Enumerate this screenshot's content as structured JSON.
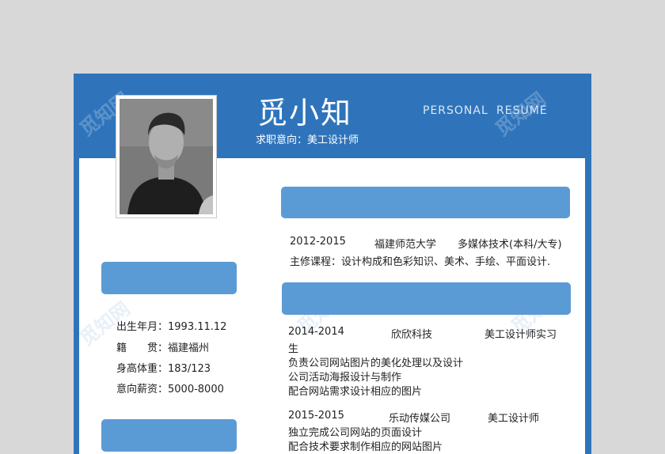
{
  "header": {
    "name": "觅小知",
    "job_intent": "求职意向：美工设计师",
    "en_word_1": "PERSONAL",
    "en_word_2": "RESUME"
  },
  "personal_info": [
    {
      "label": "出生年月：",
      "value": "1993.11.12"
    },
    {
      "label": "籍　　贯：",
      "value": "福建福州"
    },
    {
      "label": "身高体重：",
      "value": "183/123"
    },
    {
      "label": "意向薪资：",
      "value": "5000-8000"
    }
  ],
  "education": {
    "period": "2012-2015",
    "school": "福建师范大学",
    "major": "多媒体技术(本科/大专)",
    "courses": "主修课程：设计构成和色彩知识、美术、手绘、平面设计."
  },
  "experience": [
    {
      "period": "2014-2014",
      "company": "欣欣科技",
      "role": "美工设计师实习",
      "role_wrap": "生",
      "duties": [
        "负责公司网站图片的美化处理以及设计",
        "公司活动海报设计与制作",
        "配合网站需求设计相应的图片"
      ]
    },
    {
      "period": "2015-2015",
      "company": "乐动传媒公司",
      "role": "美工设计师",
      "duties": [
        "独立完成公司网站的页面设计",
        "配合技术要求制作相应的网站图片"
      ]
    }
  ],
  "watermark": "觅知网",
  "colors": {
    "primary": "#2f74bb",
    "bar": "#5b9bd5"
  }
}
